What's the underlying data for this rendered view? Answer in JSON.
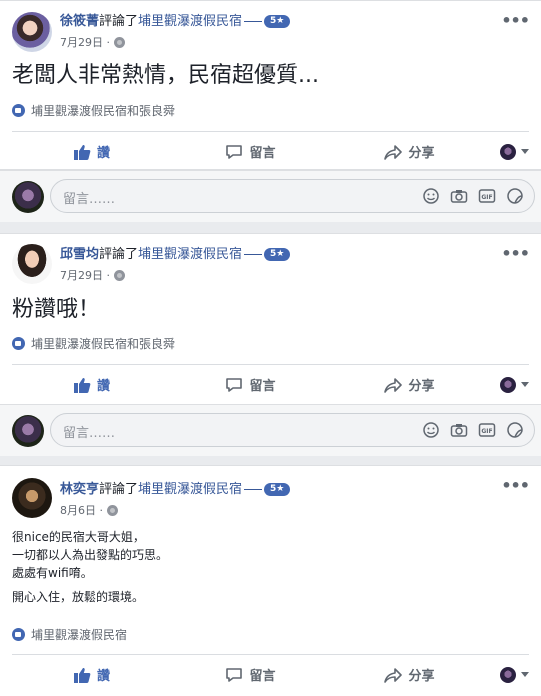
{
  "posts": [
    {
      "author": "徐筱菁",
      "action": "評論了",
      "page": "埔里觀瀑渡假民宿",
      "rating": "5★",
      "date": "7月29日",
      "body": [
        "老闆人非常熱情，民宿超優質..."
      ],
      "likes": "埔里觀瀑渡假民宿和張良舜"
    },
    {
      "author": "邱雪均",
      "action": "評論了",
      "page": "埔里觀瀑渡假民宿",
      "rating": "5★",
      "date": "7月29日",
      "body": [
        "粉讚哦！"
      ],
      "likes": "埔里觀瀑渡假民宿和張良舜"
    },
    {
      "author": "林奕亨",
      "action": "評論了",
      "page": "埔里觀瀑渡假民宿",
      "rating": "5★",
      "date": "8月6日",
      "body": [
        "很nice的民宿大哥大姐，",
        "一切都以人為出發點的巧思。",
        "處處有wifi唷。",
        "開心入住，放鬆的環境。"
      ],
      "likes": "埔里觀瀑渡假民宿"
    }
  ],
  "actions": {
    "like": "讚",
    "comment": "留言",
    "share": "分享"
  },
  "comment_placeholder": "留言……",
  "icons": {
    "like": "thumbs-up-icon",
    "comment": "speech-bubble-icon",
    "share": "share-arrow-icon",
    "emoji": "emoji-icon",
    "camera": "camera-icon",
    "gif": "gif-icon",
    "sticker": "sticker-icon",
    "globe": "globe-icon",
    "more": "more-options-icon"
  },
  "colors": {
    "link": "#385898",
    "accent": "#4267b2",
    "muted": "#606770"
  }
}
